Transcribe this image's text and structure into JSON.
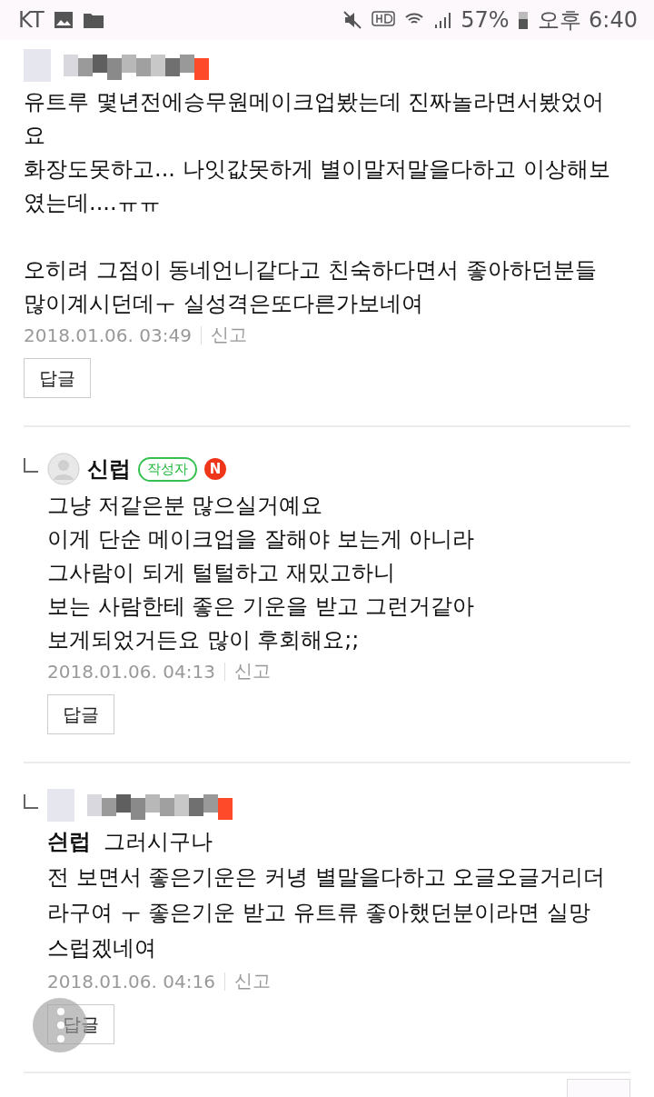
{
  "status_bar": {
    "carrier": "KT",
    "battery": "57%",
    "time": "오후 6:40"
  },
  "comments": [
    {
      "kind": "comment",
      "author_hidden": true,
      "body": "유트루 몇년전에승무원메이크업봤는데 진짜놀라면서봤었어\n요\n화장도못하고... 나잇값못하게 별이말저말을다하고 이상해보\n였는데....ㅠㅠ\n\n오히려 그점이 동네언니같다고 친숙하다면서 좋아하던분들\n많이계시던데ㅜ 실성격은또다른가보네여",
      "date": "2018.01.06. 03:49",
      "report": "신고",
      "reply_button": "답글"
    },
    {
      "kind": "reply",
      "author": "신럽",
      "badge": "작성자",
      "new_mark": "N",
      "body": "그냥 저같은분 많으실거예요\n이게 단순 메이크업을 잘해야 보는게 아니라\n그사람이 되게 털털하고 재밌고하니\n보는 사람한테 좋은 기운을 받고 그런거같아\n보게되었거든요 많이 후회해요;;",
      "date": "2018.01.06. 04:13",
      "report": "신고",
      "reply_button": "답글"
    },
    {
      "kind": "reply",
      "author_hidden": true,
      "mention": "싄럽",
      "body": "그러시구나\n전 보면서 좋은기운은 커녕 별말을다하고 오글오글거리더\n라구여 ㅜ 좋은기운 받고 유트류 좋아했던분이라면 실망\n스럽겠네여",
      "date": "2018.01.06. 04:16",
      "report": "신고",
      "reply_button": "답글"
    }
  ]
}
